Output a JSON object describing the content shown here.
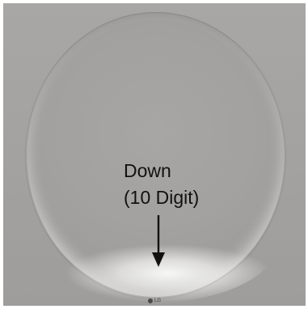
{
  "annotation": {
    "line1": "Down",
    "line2": "(10 Digit)"
  },
  "logo": {
    "text": "LG"
  },
  "colors": {
    "panel": "#a6a4a2",
    "text": "#111111",
    "arrow": "#111111"
  },
  "icons": {
    "arrow": "arrow-down-icon",
    "logo": "brand-logo-icon"
  }
}
